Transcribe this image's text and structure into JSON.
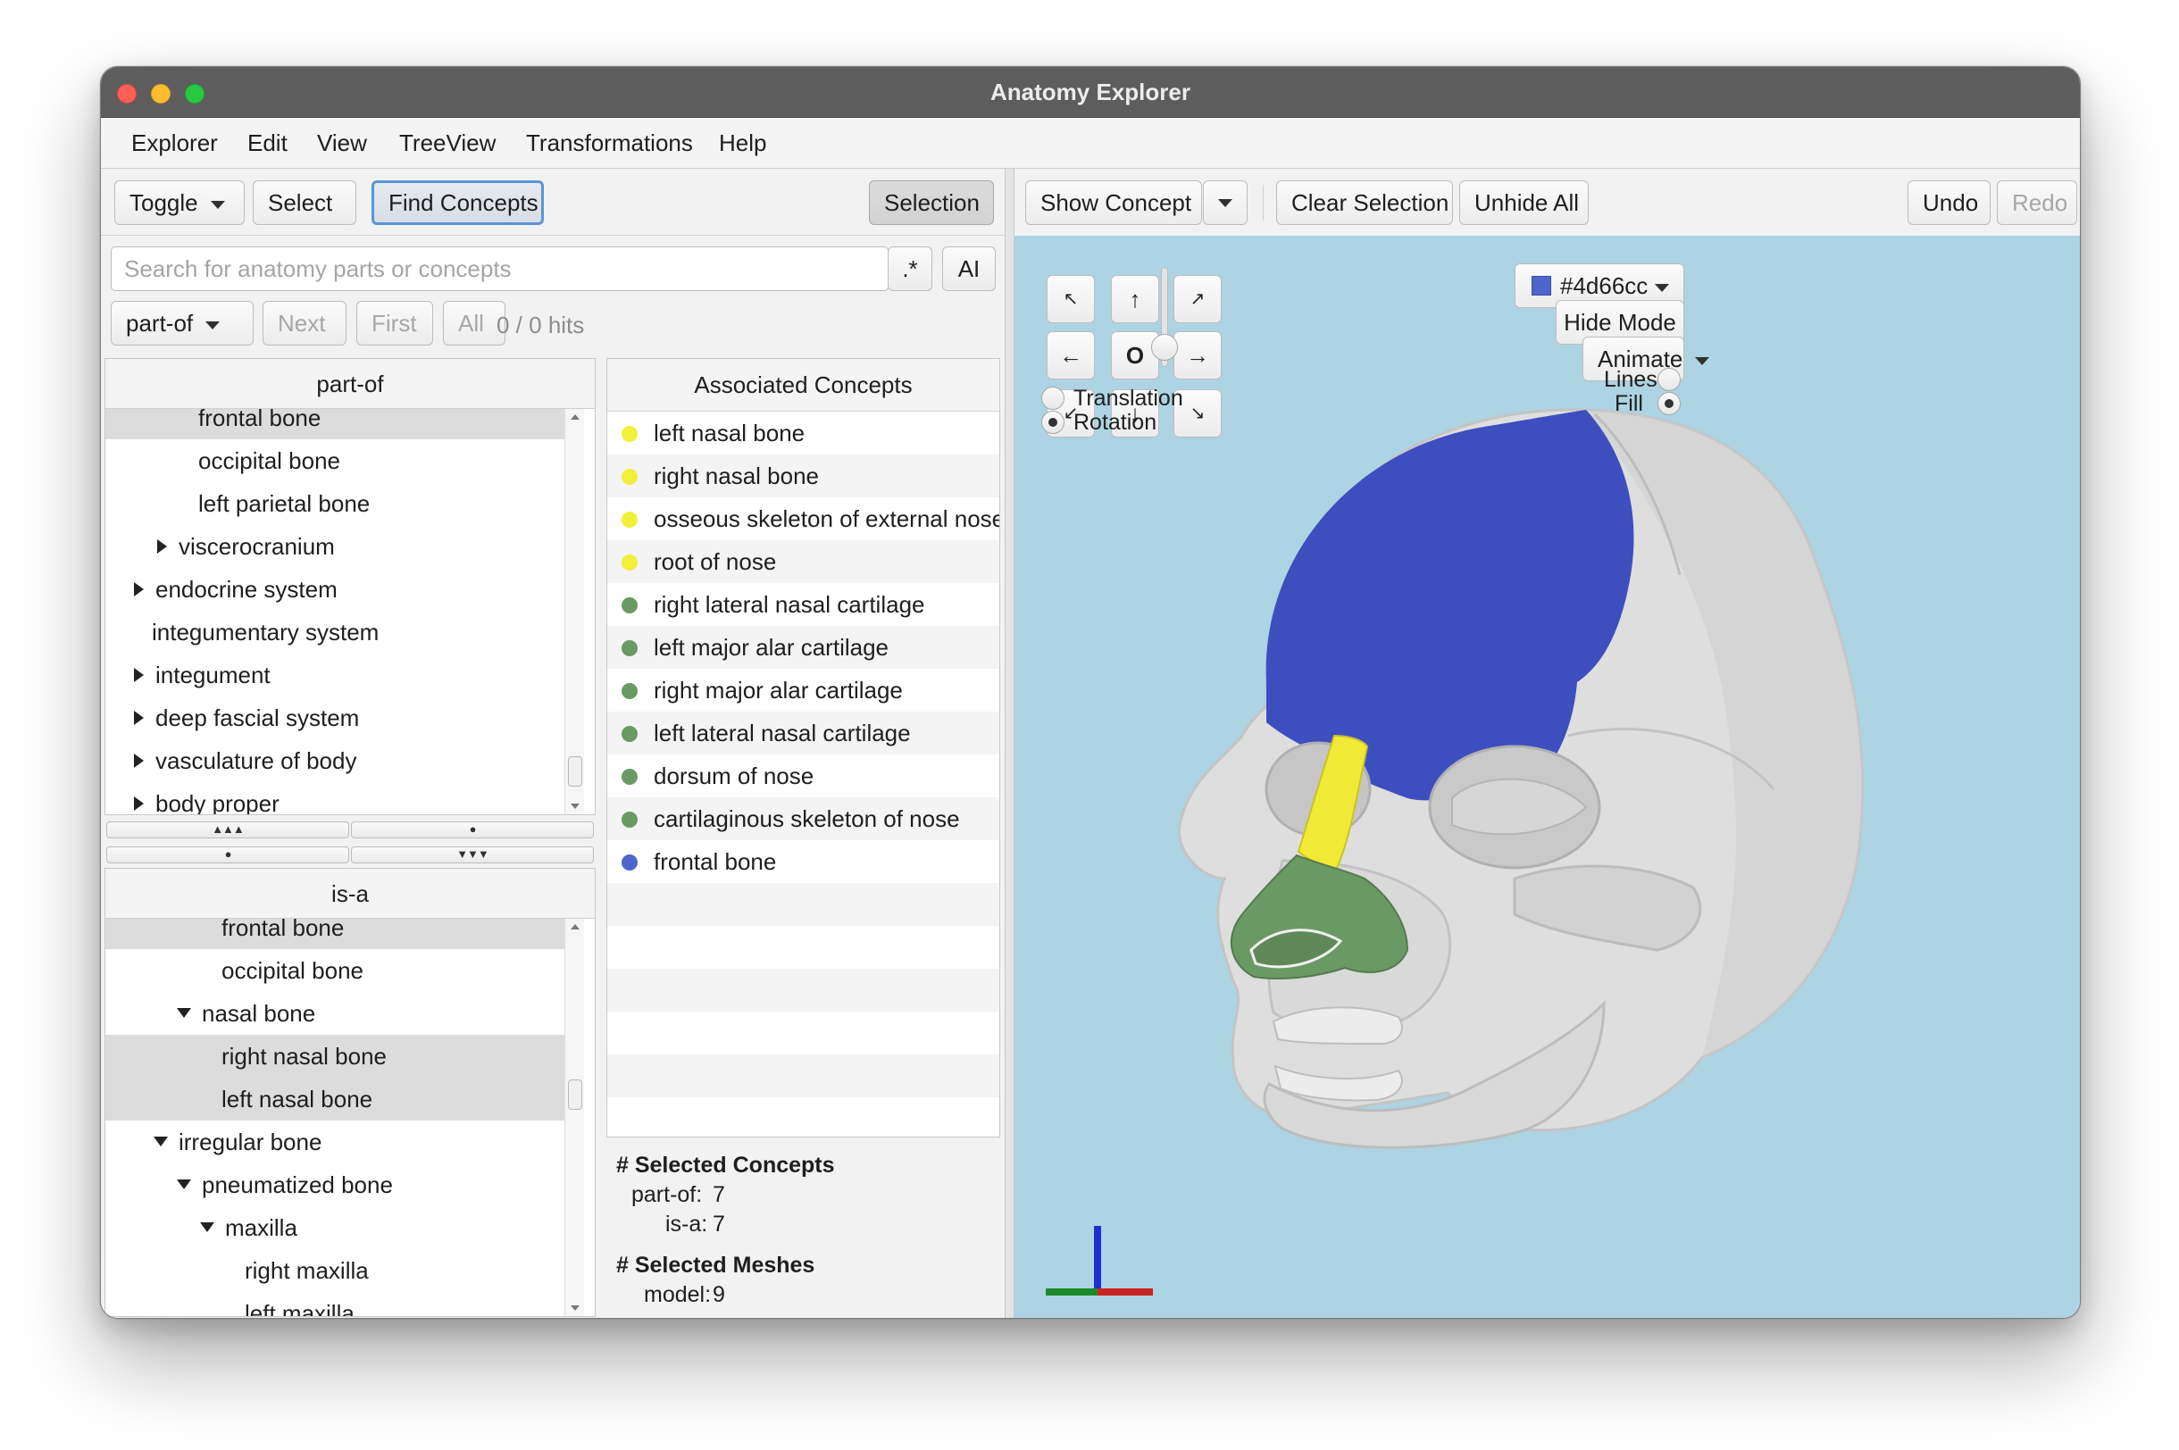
{
  "window": {
    "title": "Anatomy Explorer"
  },
  "menu": [
    "Explorer",
    "Edit",
    "View",
    "TreeView",
    "Transformations",
    "Help"
  ],
  "left_toolbar": {
    "toggle": "Toggle",
    "select": "Select",
    "find_concepts": "Find Concepts",
    "selection": "Selection"
  },
  "search": {
    "placeholder": "Search for anatomy parts or concepts",
    "regex_btn": ".*",
    "ai_btn": "AI",
    "relation": "part-of",
    "next": "Next",
    "first": "First",
    "all": "All",
    "hits": "0 / 0 hits"
  },
  "partof_tree": {
    "header": "part-of",
    "rows": [
      {
        "label": "frontal bone",
        "depth": 3,
        "expander": "none",
        "selected": true
      },
      {
        "label": "occipital bone",
        "depth": 3,
        "expander": "none",
        "selected": false
      },
      {
        "label": "left parietal bone",
        "depth": 3,
        "expander": "none",
        "selected": false
      },
      {
        "label": "viscerocranium",
        "depth": 2,
        "expander": "collapsed",
        "selected": false
      },
      {
        "label": "endocrine system",
        "depth": 1,
        "expander": "collapsed",
        "selected": false
      },
      {
        "label": "integumentary system",
        "depth": 1,
        "expander": "none",
        "selected": false
      },
      {
        "label": "integument",
        "depth": 1,
        "expander": "collapsed",
        "selected": false
      },
      {
        "label": "deep fascial system",
        "depth": 1,
        "expander": "collapsed",
        "selected": false
      },
      {
        "label": "vasculature of body",
        "depth": 1,
        "expander": "collapsed",
        "selected": false
      },
      {
        "label": "body proper",
        "depth": 1,
        "expander": "collapsed",
        "selected": false
      }
    ]
  },
  "divider_buttons": [
    "▲▲▲",
    "●",
    "●",
    "▼▼▼"
  ],
  "isa_tree": {
    "header": "is-a",
    "rows": [
      {
        "label": "frontal bone",
        "depth": 4,
        "expander": "none",
        "selected": true
      },
      {
        "label": "occipital bone",
        "depth": 4,
        "expander": "none",
        "selected": false
      },
      {
        "label": "nasal bone",
        "depth": 3,
        "expander": "expanded",
        "selected": false
      },
      {
        "label": "right nasal bone",
        "depth": 4,
        "expander": "none",
        "selected": true
      },
      {
        "label": "left nasal bone",
        "depth": 4,
        "expander": "none",
        "selected": true
      },
      {
        "label": "irregular bone",
        "depth": 2,
        "expander": "expanded",
        "selected": false
      },
      {
        "label": "pneumatized bone",
        "depth": 3,
        "expander": "expanded",
        "selected": false
      },
      {
        "label": "maxilla",
        "depth": 4,
        "expander": "expanded",
        "selected": false
      },
      {
        "label": "right maxilla",
        "depth": 5,
        "expander": "none",
        "selected": false
      },
      {
        "label": "left maxilla",
        "depth": 5,
        "expander": "none",
        "selected": false
      }
    ]
  },
  "associated": {
    "header": "Associated Concepts",
    "items": [
      {
        "label": "left nasal bone",
        "color": "#f2ef3a"
      },
      {
        "label": "right nasal bone",
        "color": "#f2ef3a"
      },
      {
        "label": "osseous skeleton of external nose",
        "color": "#f2ef3a"
      },
      {
        "label": "root of nose",
        "color": "#f2ef3a"
      },
      {
        "label": "right lateral nasal cartilage",
        "color": "#6a9a63"
      },
      {
        "label": "left major alar cartilage",
        "color": "#6a9a63"
      },
      {
        "label": "right major alar cartilage",
        "color": "#6a9a63"
      },
      {
        "label": "left lateral nasal cartilage",
        "color": "#6a9a63"
      },
      {
        "label": "dorsum of nose",
        "color": "#6a9a63"
      },
      {
        "label": "cartilaginous skeleton of nose",
        "color": "#6a9a63"
      },
      {
        "label": "frontal bone",
        "color": "#4d66cc"
      }
    ]
  },
  "stats": {
    "selected_concepts_title": "# Selected Concepts",
    "partof_label": "part-of:",
    "partof_value": "7",
    "isa_label": "is-a:",
    "isa_value": "7",
    "selected_meshes_title": "# Selected Meshes",
    "model_label": "model:",
    "model_value": "9"
  },
  "right_toolbar": {
    "show_concept": "Show Concept",
    "clear_selection": "Clear Selection",
    "unhide_all": "Unhide All",
    "undo": "Undo",
    "redo": "Redo"
  },
  "viewport": {
    "background": "#add4e2",
    "color_picker": {
      "value": "#4d66cc",
      "swatch": "#4d66cc"
    },
    "hide_mode": "Hide Mode",
    "animate": "Animate",
    "lines": "Lines",
    "fill": "Fill",
    "render_mode": "Fill",
    "translation": "Translation",
    "rotation": "Rotation",
    "control_mode": "Rotation",
    "nav_buttons": [
      {
        "glyph": "↖",
        "name": "rotate-up-left-button"
      },
      {
        "glyph": "↑",
        "name": "rotate-up-button"
      },
      {
        "glyph": "↗",
        "name": "rotate-up-right-button"
      },
      {
        "glyph": "←",
        "name": "rotate-left-button"
      },
      {
        "glyph": "O",
        "name": "reset-view-button"
      },
      {
        "glyph": "→",
        "name": "rotate-right-button"
      },
      {
        "glyph": "↙",
        "name": "rotate-down-left-button"
      },
      {
        "glyph": "↓",
        "name": "rotate-down-button"
      },
      {
        "glyph": "↘",
        "name": "rotate-down-right-button"
      }
    ],
    "zoom_level": 0.2,
    "axes_colors": {
      "x": "#cc2222",
      "y": "#1f2fcf",
      "z": "#1c8a2a"
    },
    "mesh_colors": {
      "bone": "#dedede",
      "frontal": "#3d4fbf",
      "nasal_bone": "#f0ea36",
      "cartilage": "#6a9a63"
    }
  }
}
